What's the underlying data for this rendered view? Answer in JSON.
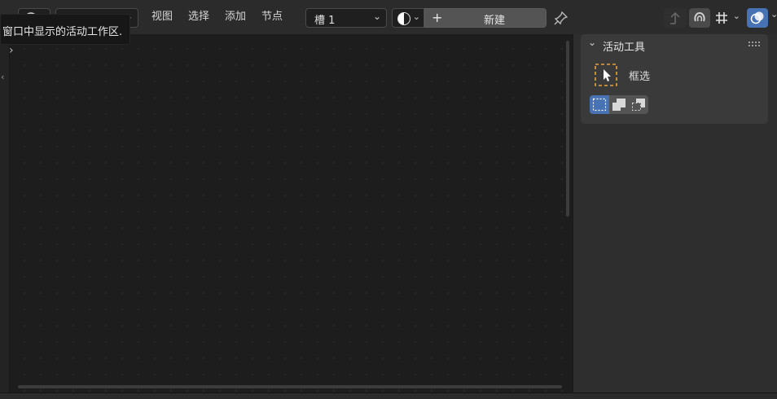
{
  "header": {
    "menus": [
      "视图",
      "选择",
      "添加",
      "节点"
    ],
    "slot_select": {
      "value": "槽 1"
    },
    "new_button": {
      "label": "新建",
      "plus": "+"
    }
  },
  "tooltip": {
    "text": "窗口中显示的活动工作区."
  },
  "sidebar": {
    "panel_title": "活动工具",
    "tool_name": "框选"
  },
  "colors": {
    "accent_blue": "#4772b3",
    "dashed_orange": "#e8a33a",
    "canvas_bg": "#1d1d1d",
    "header_bg": "#2b2b2b",
    "sidebar_bg": "#2e2e2e",
    "panel_bg": "#3a3a3a"
  },
  "icons": {
    "editor_type": "globe-icon",
    "slot_dropdown": "chevron-down-icon",
    "shading": "shading-sphere-icon",
    "pin": "pin-icon",
    "parent": "arrow-up-icon",
    "snap": "magnet-icon",
    "view_options": "grid-icon",
    "overlay": "overlay-icon",
    "panel_toggle": "chevron-down-icon",
    "drag_handle": "grip-icon",
    "tool": "cursor-select-box-icon",
    "mode_new": "select-new-icon",
    "mode_extend": "select-extend-icon",
    "mode_subtract": "select-subtract-icon",
    "sidebar_expand": "chevron-right-icon"
  }
}
